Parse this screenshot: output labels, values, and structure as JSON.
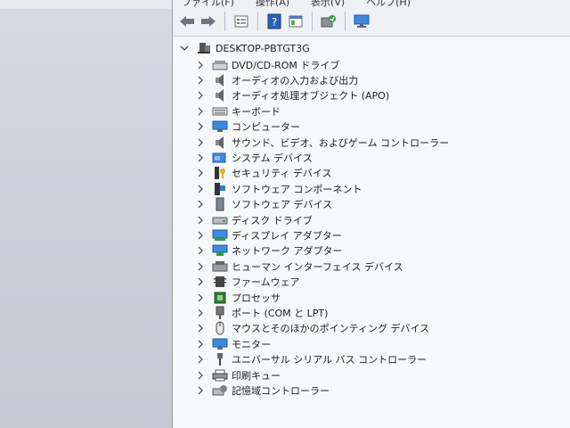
{
  "menu": [
    "ファイル(F)",
    "操作(A)",
    "表示(V)",
    "ヘルプ(H)"
  ],
  "toolbar": [
    "back-icon",
    "forward-icon",
    "properties-icon",
    "help-icon",
    "show-hide-icon",
    "scan-hardware-icon",
    "monitor-icon"
  ],
  "tree": {
    "root": "DESKTOP-PBTGT3G",
    "items": [
      {
        "label": "DVD/CD-ROM ドライブ",
        "icon": "dvd-drive-icon"
      },
      {
        "label": "オーディオの入力および出力",
        "icon": "speaker-icon"
      },
      {
        "label": "オーディオ処理オブジェクト (APO)",
        "icon": "speaker-icon"
      },
      {
        "label": "キーボード",
        "icon": "keyboard-icon"
      },
      {
        "label": "コンピューター",
        "icon": "computer-icon"
      },
      {
        "label": "サウンド、ビデオ、およびゲーム コントローラー",
        "icon": "speaker-icon"
      },
      {
        "label": "システム デバイス",
        "icon": "system-device-icon"
      },
      {
        "label": "セキュリティ デバイス",
        "icon": "security-key-icon"
      },
      {
        "label": "ソフトウェア コンポーネント",
        "icon": "software-component-icon"
      },
      {
        "label": "ソフトウェア デバイス",
        "icon": "software-device-icon"
      },
      {
        "label": "ディスク ドライブ",
        "icon": "disk-drive-icon"
      },
      {
        "label": "ディスプレイ アダプター",
        "icon": "display-adapter-icon"
      },
      {
        "label": "ネットワーク アダプター",
        "icon": "network-adapter-icon"
      },
      {
        "label": "ヒューマン インターフェイス デバイス",
        "icon": "hid-icon"
      },
      {
        "label": "ファームウェア",
        "icon": "firmware-icon"
      },
      {
        "label": "プロセッサ",
        "icon": "processor-icon"
      },
      {
        "label": "ポート (COM と LPT)",
        "icon": "port-icon"
      },
      {
        "label": "マウスとそのほかのポインティング デバイス",
        "icon": "mouse-icon"
      },
      {
        "label": "モニター",
        "icon": "monitor-icon"
      },
      {
        "label": "ユニバーサル シリアル バス コントローラー",
        "icon": "usb-icon"
      },
      {
        "label": "印刷キュー",
        "icon": "printer-icon"
      },
      {
        "label": "記憶域コントローラー",
        "icon": "storage-controller-icon"
      }
    ]
  },
  "colors": {
    "accent": "#2b78c4",
    "window_bg": "#f7f8fa",
    "desktop_bg": "#c9cdd8"
  }
}
